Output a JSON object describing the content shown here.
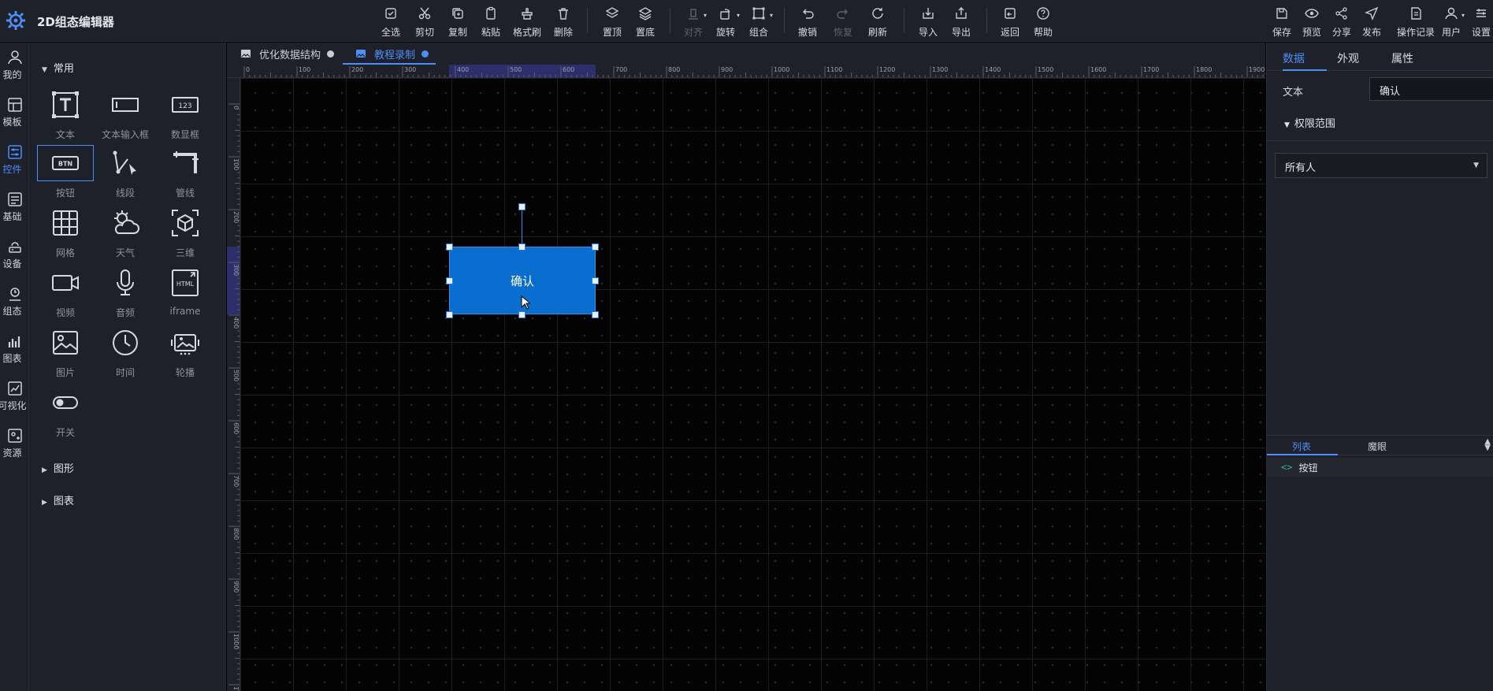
{
  "app": {
    "title": "2D组态编辑器",
    "logo_icon": "gear-logo-icon"
  },
  "toolbar": {
    "select_all": "全选",
    "cut": "剪切",
    "copy": "复制",
    "paste": "粘贴",
    "format_brush": "格式刷",
    "delete": "删除",
    "bring_top": "置顶",
    "send_bottom": "置底",
    "align": "对齐",
    "rotate": "旋转",
    "group": "组合",
    "undo": "撤销",
    "redo": "恢复",
    "refresh": "刷新",
    "import": "导入",
    "export": "导出",
    "back": "返回",
    "help": "帮助",
    "save": "保存",
    "preview": "预览",
    "share": "分享",
    "publish": "发布",
    "history": "操作记录",
    "user": "用户",
    "settings": "设置"
  },
  "rail": {
    "items": [
      {
        "label": "我的",
        "icon": "person-icon"
      },
      {
        "label": "模板",
        "icon": "template-icon"
      },
      {
        "label": "控件",
        "icon": "controls-icon",
        "active": true
      },
      {
        "label": "基础",
        "icon": "basic-icon"
      },
      {
        "label": "设备",
        "icon": "device-icon"
      },
      {
        "label": "组态",
        "icon": "config-icon"
      },
      {
        "label": "图表",
        "icon": "chart-icon"
      },
      {
        "label": "可视化",
        "icon": "visualization-icon"
      },
      {
        "label": "资源",
        "icon": "resource-icon"
      }
    ]
  },
  "panel": {
    "common_title": "常用",
    "components": [
      "文本",
      "文本输入框",
      "数显框",
      "按钮",
      "线段",
      "管线",
      "网格",
      "天气",
      "三维",
      "视频",
      "音频",
      "iframe",
      "图片",
      "时间",
      "轮播",
      "开关"
    ],
    "shapes_title": "图形",
    "charts_title": "图表"
  },
  "tabs": [
    {
      "label": "优化数据结构",
      "active": false
    },
    {
      "label": "教程录制",
      "active": true
    }
  ],
  "ruler": {
    "h_ticks": [
      "0",
      "100",
      "200",
      "300",
      "400",
      "500",
      "600",
      "700",
      "800",
      "900",
      "1000",
      "1100",
      "1200",
      "1300",
      "1400",
      "1500",
      "1600",
      "1700",
      "1800",
      "1900"
    ],
    "v_ticks": [
      "0",
      "100",
      "200",
      "300",
      "400",
      "500",
      "600",
      "700",
      "800",
      "900",
      "1000",
      "1100"
    ]
  },
  "canvas": {
    "widget_text": "确认",
    "widget_color": "#0a6ed1"
  },
  "props": {
    "tabs": [
      "数据",
      "外观",
      "属性"
    ],
    "text_label": "文本",
    "text_value": "确认",
    "permission_title": "权限范围",
    "permission_value": "所有人",
    "bottom_tabs": [
      "列表",
      "魔眼"
    ],
    "tree_item": "按钮",
    "tree_item_icon": "<>"
  },
  "colors": {
    "accent": "#4d8ef7",
    "bg": "#1e2129",
    "canvas": "#030303"
  }
}
